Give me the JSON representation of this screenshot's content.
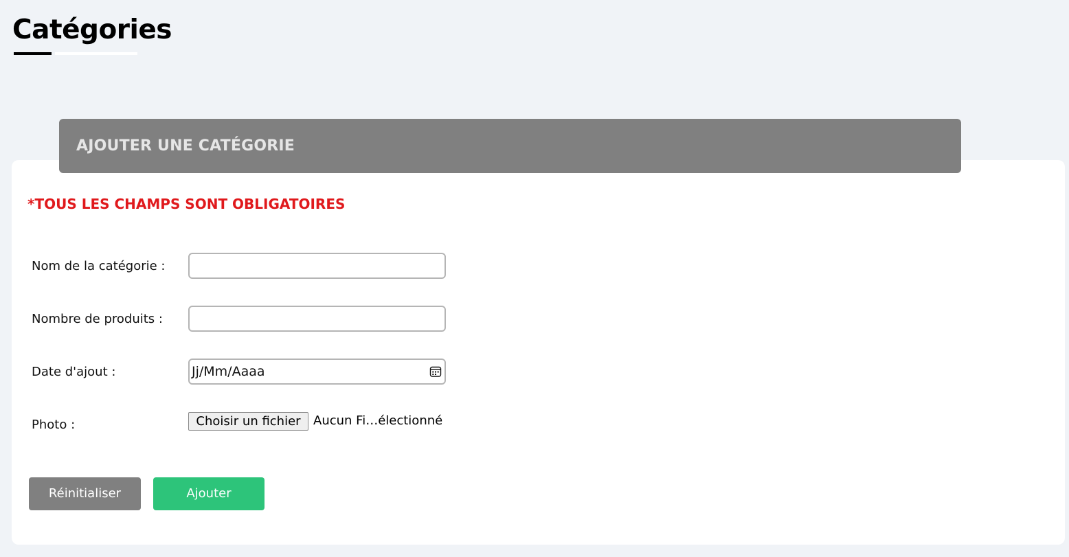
{
  "page": {
    "title": "Catégories"
  },
  "form": {
    "header_title": "AJOUTER UNE CATÉGORIE",
    "required_note": "*TOUS LES CHAMPS SONT OBLIGATOIRES",
    "fields": {
      "name": {
        "label": "Nom de la catégorie :",
        "value": ""
      },
      "count": {
        "label": "Nombre de produits :",
        "value": ""
      },
      "date": {
        "label": "Date d'ajout :",
        "placeholder": "Jj/Mm/Aaaa"
      },
      "photo": {
        "label": "Photo :",
        "button_label": "Choisir un fichier",
        "status": "Aucun Fi…électionné"
      }
    },
    "buttons": {
      "reset_label": "Réinitialiser",
      "submit_label": "Ajouter"
    }
  },
  "colors": {
    "header_bg": "#808080",
    "required_text": "#e0191c",
    "submit_bg": "#2dc47a",
    "reset_bg": "#808080",
    "page_bg": "#f0f3f7"
  },
  "icons": {
    "date_picker": "calendar-icon"
  }
}
